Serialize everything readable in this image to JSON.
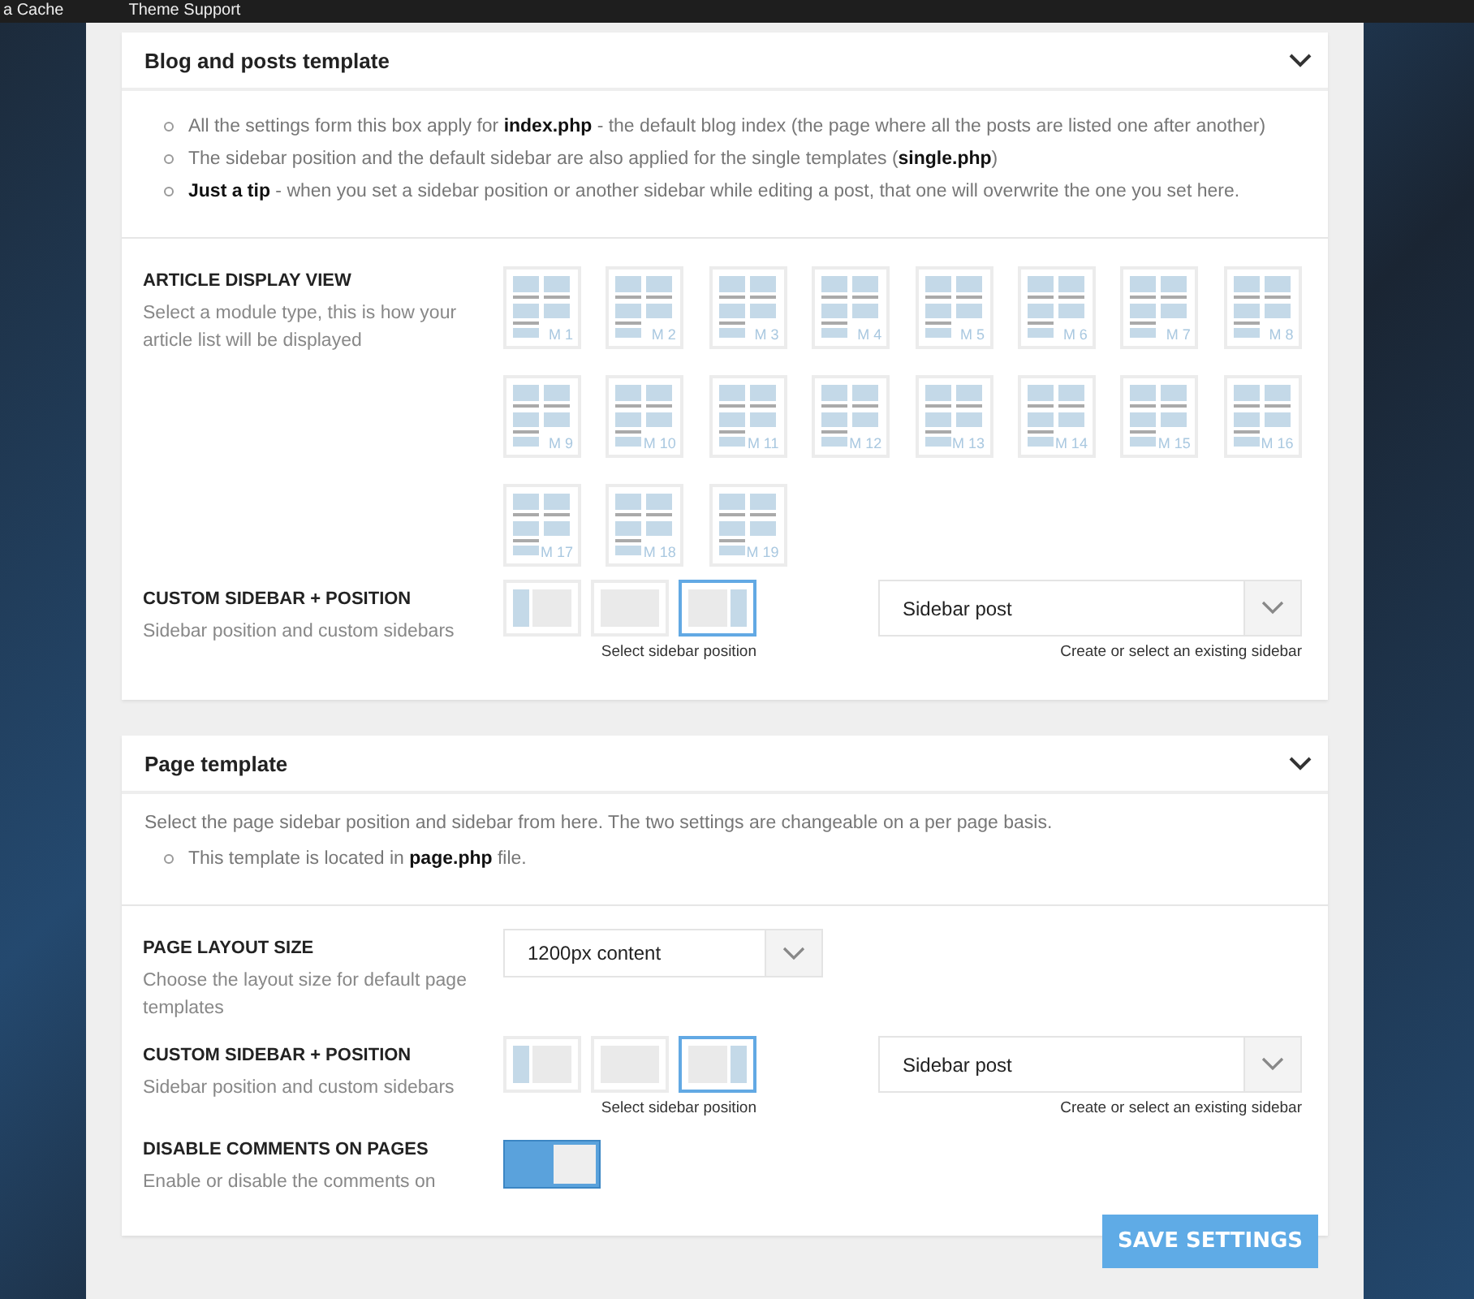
{
  "top_bar": {
    "items": [
      "a Cache",
      "Theme Support"
    ]
  },
  "sections": [
    {
      "title": "Blog and posts template",
      "expanded": true,
      "notes": [
        "All the settings form this box apply for **index.php** - the default blog index (the page where all the posts are listed one after another)",
        "The sidebar position and the default sidebar are also applied for the single templates (**single.php**)",
        "**Just a tip** - when you set a sidebar position or another sidebar while editing a post, that one will overwrite the one you set here."
      ],
      "settings": [
        {
          "kind": "modules",
          "title": "ARTICLE DISPLAY VIEW",
          "description": "Select a module type, this is how your article list will be displayed",
          "options": [
            {
              "label": "M 1",
              "selected": false
            },
            {
              "label": "M 2",
              "selected": false
            },
            {
              "label": "M 3",
              "selected": false
            },
            {
              "label": "M 4",
              "selected": false
            },
            {
              "label": "M 5",
              "selected": false
            },
            {
              "label": "M 6",
              "selected": false
            },
            {
              "label": "M 7",
              "selected": false
            },
            {
              "label": "M 8",
              "selected": false
            },
            {
              "label": "M 9",
              "selected": false
            },
            {
              "label": "M 10",
              "selected": false
            },
            {
              "label": "M 11",
              "selected": false
            },
            {
              "label": "M 12",
              "selected": false
            },
            {
              "label": "M 13",
              "selected": false
            },
            {
              "label": "M 14",
              "selected": false
            },
            {
              "label": "M 15",
              "selected": false
            },
            {
              "label": "M 16",
              "selected": false
            },
            {
              "label": "M 17",
              "selected": false
            },
            {
              "label": "M 18",
              "selected": false
            },
            {
              "label": "M 19",
              "selected": false
            }
          ]
        },
        {
          "kind": "sidebar",
          "title": "CUSTOM SIDEBAR + POSITION",
          "description": "Sidebar position and custom sidebars",
          "positions": [
            {
              "kind": "left",
              "selected": false
            },
            {
              "kind": "none",
              "selected": false
            },
            {
              "kind": "right",
              "selected": true
            }
          ],
          "positions_caption": "Select sidebar position",
          "value": "Sidebar post",
          "select_caption": "Create or select an existing sidebar"
        }
      ]
    },
    {
      "title": "Page template",
      "expanded": true,
      "intro": "Select the page sidebar position and sidebar from here. The two settings are changeable on a per page basis.",
      "notes": [
        "This template is located in **page.php** file."
      ],
      "settings": [
        {
          "kind": "select",
          "title": "PAGE LAYOUT SIZE",
          "description": "Choose the layout size for default page templates",
          "value": "1200px content"
        },
        {
          "kind": "sidebar",
          "title": "CUSTOM SIDEBAR + POSITION",
          "description": "Sidebar position and custom sidebars",
          "positions": [
            {
              "kind": "left",
              "selected": false
            },
            {
              "kind": "none",
              "selected": false
            },
            {
              "kind": "right",
              "selected": true
            }
          ],
          "positions_caption": "Select sidebar position",
          "value": "Sidebar post",
          "select_caption": "Create or select an existing sidebar"
        },
        {
          "kind": "toggle",
          "title": "DISABLE COMMENTS ON PAGES",
          "description": "Enable or disable the comments on",
          "on": true
        }
      ]
    }
  ],
  "save_button": "SAVE SETTINGS"
}
